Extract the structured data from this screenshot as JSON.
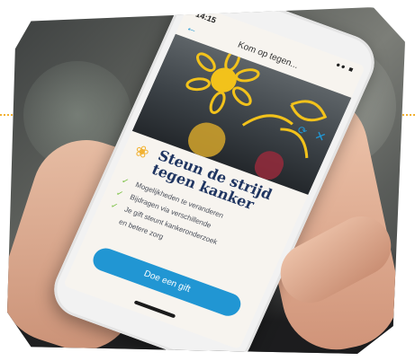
{
  "status": {
    "time": "14:15",
    "icons": "●● ■"
  },
  "nav": {
    "title": "Kom op tegen..."
  },
  "content": {
    "headline": "Steun de strijd tegen kanker",
    "bullets": [
      "Mogelijkheden te veranderen",
      "Bijdragen via verschillende",
      "Je gift steunt kankeronderzoek",
      "en betere zorg"
    ],
    "cta_label": "Doe een gift"
  },
  "colors": {
    "accent": "#2196d3",
    "headline": "#1f3561",
    "highlight": "#f2b233",
    "check": "#7ac142"
  }
}
